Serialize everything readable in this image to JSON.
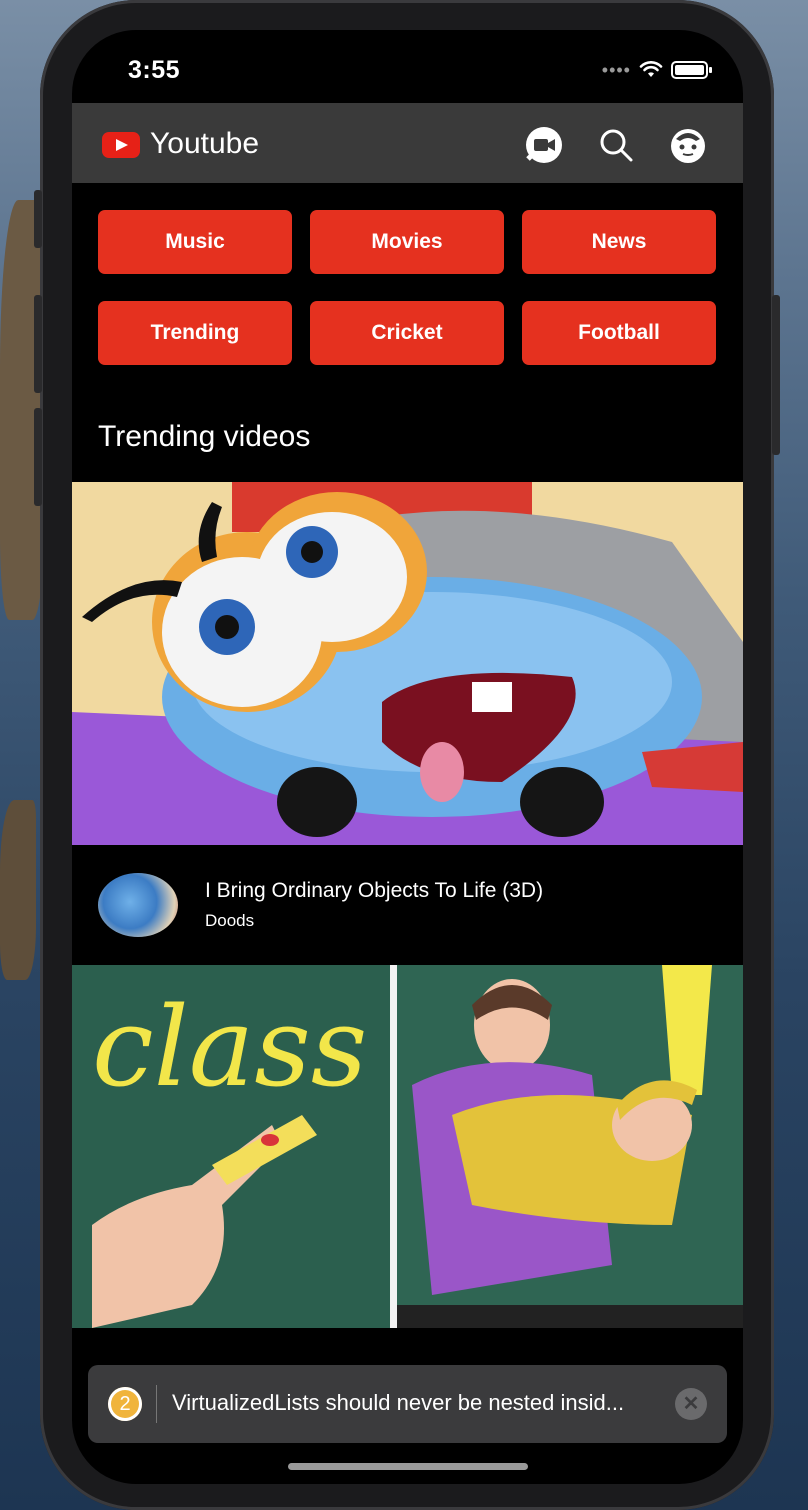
{
  "status_bar": {
    "time": "3:55"
  },
  "app_bar": {
    "title": "Youtube",
    "icons": [
      "video-camera-icon",
      "search-icon",
      "profile-icon"
    ]
  },
  "categories": [
    "Music",
    "Movies",
    "News",
    "Trending",
    "Cricket",
    "Football"
  ],
  "section_title": "Trending videos",
  "videos": [
    {
      "title": "I Bring Ordinary Objects To Life (3D)",
      "channel": "Doods",
      "thumbnail_text": ""
    },
    {
      "title": "",
      "channel": "",
      "thumbnail_text": "class"
    }
  ],
  "toast": {
    "count": "2",
    "message": "VirtualizedLists should never be nested insid..."
  },
  "colors": {
    "accent": "#e5311f",
    "app_bar": "#3a3a3a",
    "background": "#000000"
  }
}
